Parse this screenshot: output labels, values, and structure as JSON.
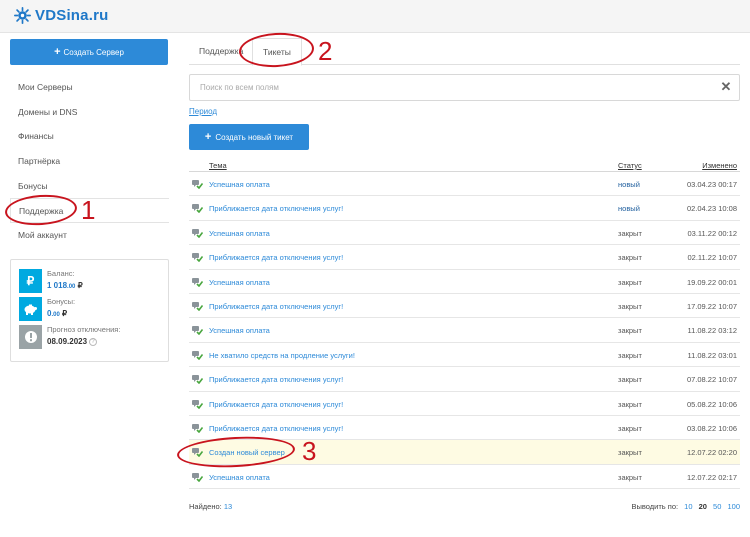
{
  "brand": {
    "name": "VDSina.ru"
  },
  "sidebar": {
    "create_label": "Создать Сервер",
    "items": [
      {
        "label": "Мои Серверы"
      },
      {
        "label": "Домены и DNS"
      },
      {
        "label": "Финансы"
      },
      {
        "label": "Партнёрка"
      },
      {
        "label": "Бонусы"
      },
      {
        "label": "Поддержка"
      },
      {
        "label": "Мой аккаунт"
      }
    ],
    "active_item": "Поддержка"
  },
  "balance_card": {
    "balance_label": "Баланс:",
    "balance_main": "1 018",
    "balance_cents": ".00",
    "bonus_label": "Бонусы:",
    "bonus_main": "0",
    "bonus_cents": ".00",
    "currency": "₽",
    "shutdown_label": "Прогноз отключения:",
    "shutdown_date": "08.09.2023",
    "help_mark": "?"
  },
  "tabs": [
    {
      "label": "Поддержка"
    },
    {
      "label": "Тикеты"
    }
  ],
  "active_tab": "Тикеты",
  "search": {
    "placeholder": "Поиск по всем полям",
    "value": "",
    "clear_icon": "✕"
  },
  "period_link": "Период",
  "new_ticket_label": "Создать новый тикет",
  "table": {
    "columns": {
      "subject": "Тема",
      "status": "Статус",
      "changed": "Изменено"
    },
    "rows": [
      {
        "subject": "Успешная оплата",
        "status": "новый",
        "changed": "03.04.23 00:17"
      },
      {
        "subject": "Приближается дата отключения услуг!",
        "status": "новый",
        "changed": "02.04.23 10:08"
      },
      {
        "subject": "Успешная оплата",
        "status": "закрыт",
        "changed": "03.11.22 00:12"
      },
      {
        "subject": "Приближается дата отключения услуг!",
        "status": "закрыт",
        "changed": "02.11.22 10:07"
      },
      {
        "subject": "Успешная оплата",
        "status": "закрыт",
        "changed": "19.09.22 00:01"
      },
      {
        "subject": "Приближается дата отключения услуг!",
        "status": "закрыт",
        "changed": "17.09.22 10:07"
      },
      {
        "subject": "Успешная оплата",
        "status": "закрыт",
        "changed": "11.08.22 03:12"
      },
      {
        "subject": "Не хватило средств на продление услуги!",
        "status": "закрыт",
        "changed": "11.08.22 03:01"
      },
      {
        "subject": "Приближается дата отключения услуг!",
        "status": "закрыт",
        "changed": "07.08.22 10:07"
      },
      {
        "subject": "Приближается дата отключения услуг!",
        "status": "закрыт",
        "changed": "05.08.22 10:06"
      },
      {
        "subject": "Приближается дата отключения услуг!",
        "status": "закрыт",
        "changed": "03.08.22 10:06"
      },
      {
        "subject": "Создан новый сервер",
        "status": "закрыт",
        "changed": "12.07.22 02:20"
      },
      {
        "subject": "Успешная оплата",
        "status": "закрыт",
        "changed": "12.07.22 02:17"
      }
    ],
    "highlighted_row": 12
  },
  "footer": {
    "found_label": "Найдено:",
    "found_count": "13",
    "per_page_label": "Выводить по:",
    "per_page_options": [
      "10",
      "20",
      "50",
      "100"
    ],
    "per_page_selected": "20"
  },
  "annotations": {
    "one": "1",
    "two": "2",
    "three": "3"
  },
  "colors": {
    "accent": "#2d8ad8",
    "annotation": "#c8141e",
    "highlight": "#fefbe3",
    "balance_icon": "#00a9e0",
    "bonus_icon": "#00a9e0",
    "shutdown_icon": "#9aa3a6"
  }
}
